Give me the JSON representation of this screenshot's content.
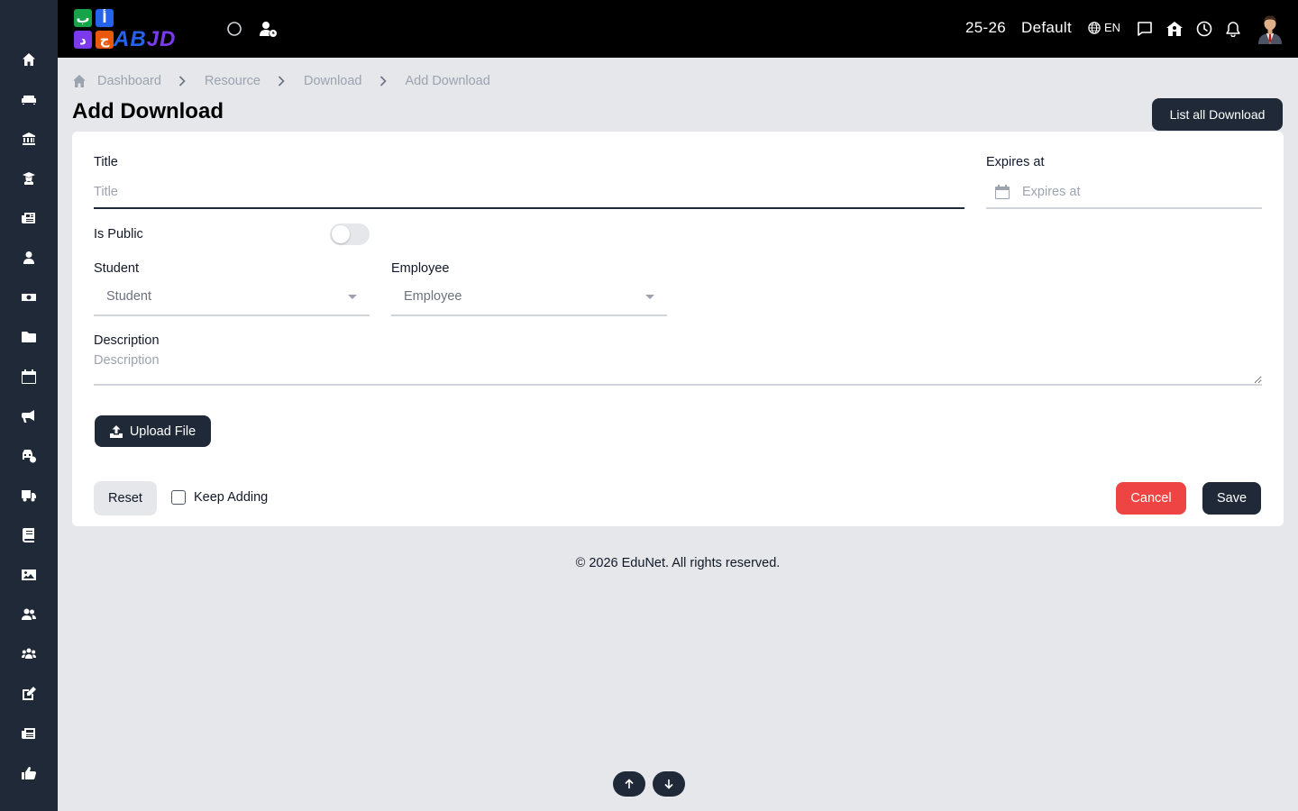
{
  "app": {
    "logo_text": "ABJD",
    "logo_tiles": [
      "ب",
      "أ",
      "د",
      "ج"
    ],
    "brand_colors": {
      "green": "#16a34a",
      "blue": "#2563eb",
      "purple": "#7c3aed",
      "orange": "#ea580c"
    }
  },
  "topbar": {
    "session": "25-26",
    "school": "Default",
    "language": "EN",
    "icons": [
      "circle-icon",
      "user-clock-icon",
      "globe-icon",
      "message-icon",
      "school-icon",
      "clock-icon",
      "bell-icon",
      "avatar"
    ]
  },
  "sidebar": {
    "icons": [
      "home-icon",
      "couch-icon",
      "bank-icon",
      "teacher-icon",
      "newspaper-icon",
      "user-tie-icon",
      "money-icon",
      "folder-icon",
      "calendar-icon",
      "megaphone-icon",
      "vehicle-settings-icon",
      "truck-icon",
      "book-icon",
      "image-icon",
      "users-icon",
      "group-icon",
      "edit-icon",
      "news-icon",
      "thumbs-up-icon"
    ]
  },
  "breadcrumb": {
    "items": [
      "Dashboard",
      "Resource",
      "Download"
    ],
    "current": "Add Download"
  },
  "page": {
    "title": "Add Download",
    "list_button": "List all Download"
  },
  "form": {
    "title_label": "Title",
    "title_placeholder": "Title",
    "title_value": "",
    "expires_label": "Expires at",
    "expires_placeholder": "Expires at",
    "is_public_label": "Is Public",
    "is_public_value": false,
    "student_label": "Student",
    "student_value": "Student",
    "employee_label": "Employee",
    "employee_value": "Employee",
    "description_label": "Description",
    "description_placeholder": "Description",
    "upload_label": "Upload File",
    "reset_label": "Reset",
    "keep_adding_label": "Keep Adding",
    "keep_adding_checked": false,
    "cancel_label": "Cancel",
    "save_label": "Save"
  },
  "footer": {
    "text": "© 2026 EduNet. All rights reserved."
  },
  "colors": {
    "sidebar_bg": "#1f2937",
    "topbar_bg": "#000000",
    "page_bg": "#e5e7eb",
    "primary": "#1f2937",
    "danger": "#ef4444"
  }
}
